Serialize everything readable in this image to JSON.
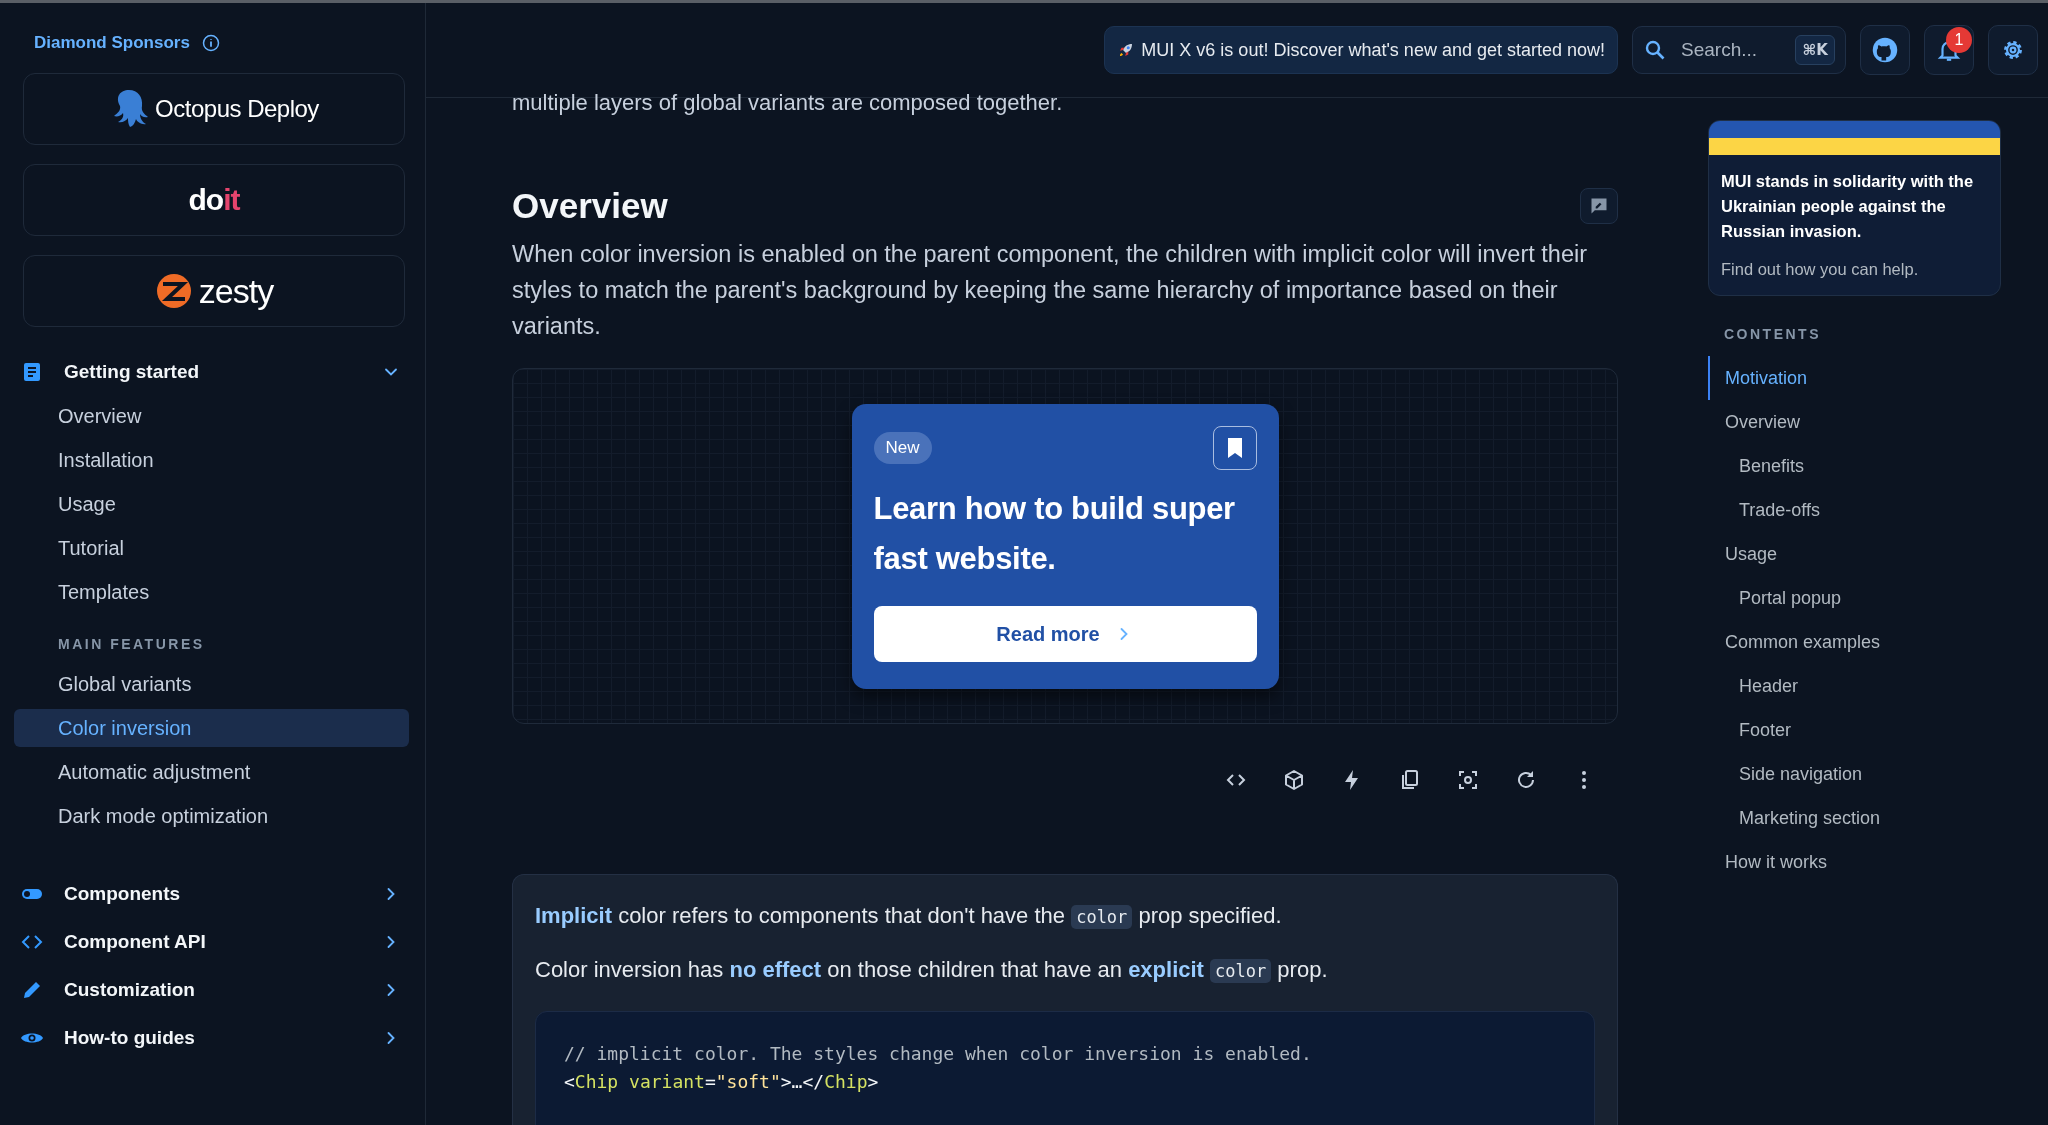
{
  "sidebar": {
    "sponsors_label": "Diamond Sponsors",
    "sponsors": [
      {
        "kind": "octopus",
        "name": "Octopus Deploy"
      },
      {
        "kind": "doit",
        "name": "do",
        "name_accent": "it"
      },
      {
        "kind": "zesty",
        "name": "zesty"
      }
    ],
    "sections": [
      {
        "label": "Getting started",
        "expanded": true,
        "items": [
          {
            "kind": "link",
            "label": "Overview",
            "selected": false
          },
          {
            "kind": "link",
            "label": "Installation",
            "selected": false
          },
          {
            "kind": "link",
            "label": "Usage",
            "selected": false
          },
          {
            "kind": "link",
            "label": "Tutorial",
            "selected": false
          },
          {
            "kind": "link",
            "label": "Templates",
            "selected": false
          },
          {
            "kind": "subheader",
            "label": "MAIN FEATURES"
          },
          {
            "kind": "link",
            "label": "Global variants",
            "selected": false
          },
          {
            "kind": "link",
            "label": "Color inversion",
            "selected": true
          },
          {
            "kind": "link",
            "label": "Automatic adjustment",
            "selected": false
          },
          {
            "kind": "link",
            "label": "Dark mode optimization",
            "selected": false
          }
        ]
      },
      {
        "label": "Components",
        "expanded": false
      },
      {
        "label": "Component API",
        "expanded": false
      },
      {
        "label": "Customization",
        "expanded": false
      },
      {
        "label": "How-to guides",
        "expanded": false
      }
    ]
  },
  "header": {
    "announcement": "MUI X v6 is out! Discover what's new and get started now!",
    "search": {
      "placeholder": "Search...",
      "shortcut": "⌘K"
    },
    "notification_count": "1"
  },
  "content": {
    "cut_line": "multiple layers of global variants are composed together.",
    "heading": "Overview",
    "intro": "When color inversion is enabled on the parent component, the children with implicit color will invert their styles to match the parent's background by keeping the same hierarchy of importance based on their variants.",
    "demo_card": {
      "chip": "New",
      "title": "Learn how to build super fast website.",
      "button": "Read more"
    },
    "note": {
      "paragraphs": [
        [
          {
            "kind": "bold",
            "text": "Implicit"
          },
          {
            "kind": "plain",
            "text": " color refers to components that don't have the "
          },
          {
            "kind": "code",
            "text": "color"
          },
          {
            "kind": "plain",
            "text": " prop specified."
          }
        ],
        [
          {
            "kind": "plain",
            "text": "Color inversion has "
          },
          {
            "kind": "bold",
            "text": "no effect"
          },
          {
            "kind": "plain",
            "text": " on those children that have an "
          },
          {
            "kind": "bold",
            "text": "explicit "
          },
          {
            "kind": "code",
            "text": "color"
          },
          {
            "kind": "plain",
            "text": " prop."
          }
        ]
      ],
      "code": [
        [
          {
            "kind": "comment",
            "text": "// implicit color. The styles change when color inversion is enabled."
          }
        ],
        [
          {
            "kind": "punct",
            "text": "<"
          },
          {
            "kind": "tag",
            "text": "Chip"
          },
          {
            "kind": "attr",
            "text": " variant"
          },
          {
            "kind": "punct",
            "text": "="
          },
          {
            "kind": "string",
            "text": "\"soft\""
          },
          {
            "kind": "punct",
            "text": ">…</"
          },
          {
            "kind": "tag",
            "text": "Chip"
          },
          {
            "kind": "punct",
            "text": ">"
          }
        ]
      ]
    }
  },
  "aside": {
    "ukraine": {
      "message": "MUI stands in solidarity with the Ukrainian people against the Russian invasion.",
      "link": "Find out how you can help."
    },
    "contents_label": "CONTENTS",
    "toc": [
      {
        "label": "Motivation",
        "selected": true
      },
      {
        "label": "Overview",
        "selected": false,
        "children": [
          {
            "label": "Benefits",
            "selected": false
          },
          {
            "label": "Trade-offs",
            "selected": false
          }
        ]
      },
      {
        "label": "Usage",
        "selected": false,
        "children": [
          {
            "label": "Portal popup",
            "selected": false
          }
        ]
      },
      {
        "label": "Common examples",
        "selected": false,
        "children": [
          {
            "label": "Header",
            "selected": false
          },
          {
            "label": "Footer",
            "selected": false
          },
          {
            "label": "Side navigation",
            "selected": false
          },
          {
            "label": "Marketing section",
            "selected": false
          }
        ]
      },
      {
        "label": "How it works",
        "selected": false
      }
    ]
  }
}
